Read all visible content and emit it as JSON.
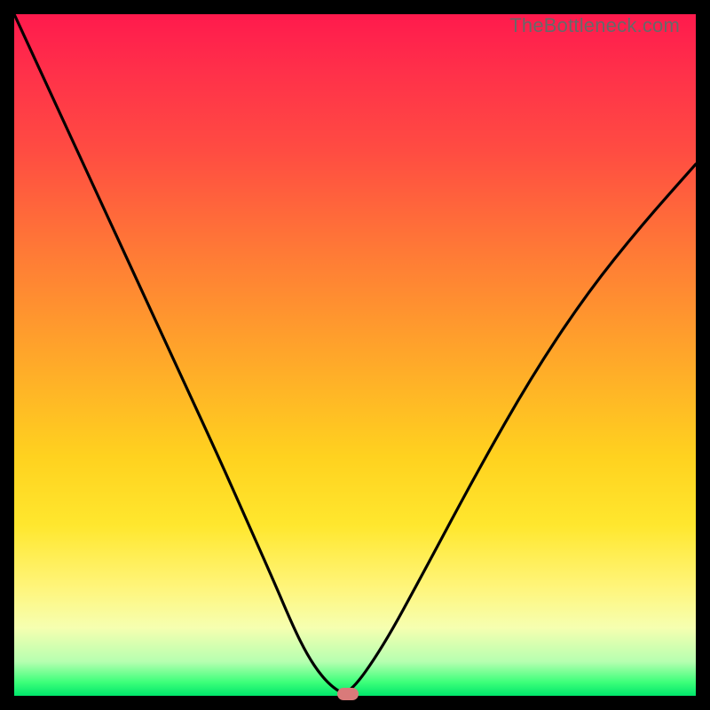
{
  "watermark_text": "TheBottleneck.com",
  "colors": {
    "frame": "#000000",
    "gradient_top": "#ff1a4d",
    "gradient_mid": "#ffd21f",
    "gradient_bottom": "#00e66b",
    "curve_stroke": "#000000",
    "marker_fill": "#d97a7a"
  },
  "chart_data": {
    "type": "line",
    "title": "",
    "xlabel": "",
    "ylabel": "",
    "xlim": [
      0,
      100
    ],
    "ylim": [
      0,
      100
    ],
    "grid": false,
    "legend": false,
    "series": [
      {
        "name": "bottleneck-curve",
        "x": [
          0,
          6,
          12,
          18,
          24,
          30,
          34,
          38,
          41,
          43,
          45,
          47,
          49,
          54,
          60,
          68,
          76,
          84,
          92,
          100
        ],
        "values": [
          100,
          87,
          74,
          61,
          48,
          35,
          26,
          17,
          10,
          6,
          3,
          1,
          0,
          7,
          18,
          33,
          47,
          59,
          69,
          78
        ]
      }
    ],
    "marker": {
      "x": 49,
      "y": 0
    },
    "annotations": []
  }
}
